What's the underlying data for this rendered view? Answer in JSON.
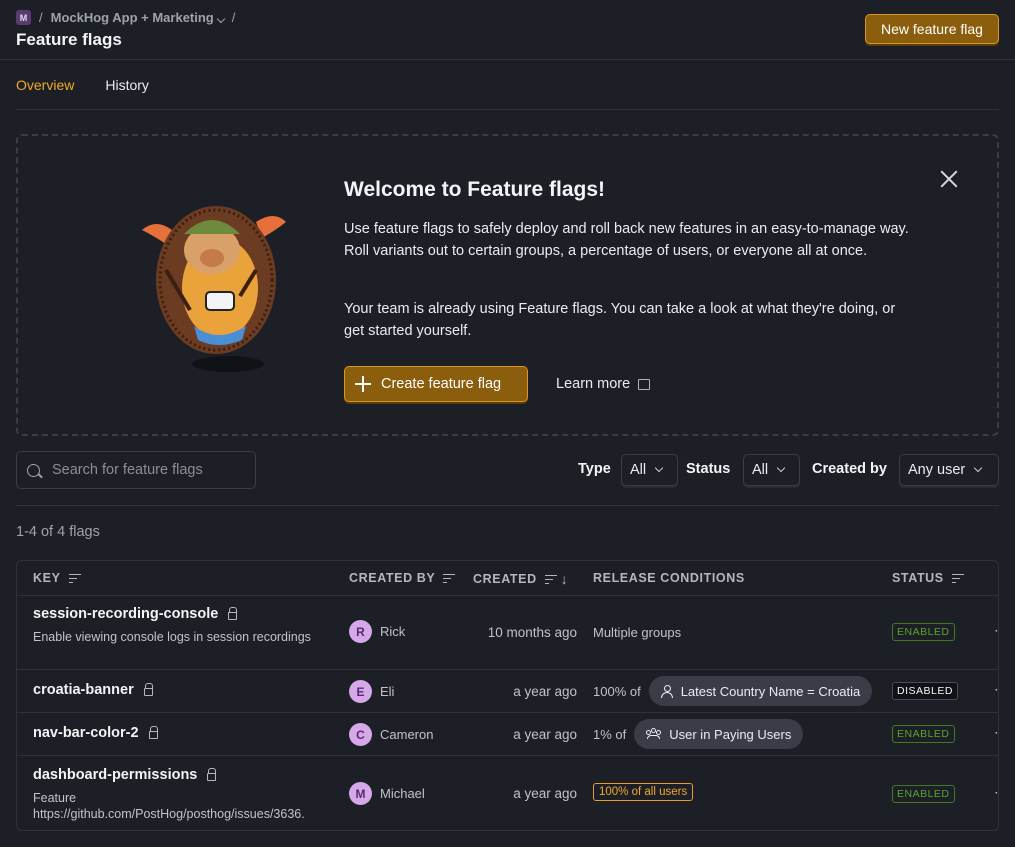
{
  "breadcrumb": {
    "badge": "M",
    "sep1": "/",
    "project": "MockHog App + Marketing",
    "sep2": "/"
  },
  "page_title": "Feature flags",
  "new_flag_button": "New feature flag",
  "tabs": [
    {
      "label": "Overview",
      "active": true
    },
    {
      "label": "History",
      "active": false
    }
  ],
  "banner": {
    "title": "Welcome to Feature flags!",
    "paragraph1": "Use feature flags to safely deploy and roll back new features in an easy-to-manage way. Roll variants out to certain groups, a percentage of users, or everyone all at once.",
    "paragraph2": "Your team is already using Feature flags. You can take a look at what they're doing, or get started yourself.",
    "create_button": "Create feature flag",
    "learn_more": "Learn more"
  },
  "filters": {
    "search_placeholder": "Search for feature flags",
    "type_label": "Type",
    "type_value": "All",
    "status_label": "Status",
    "status_value": "All",
    "created_by_label": "Created by",
    "created_by_value": "Any user"
  },
  "count_text": "1-4 of 4 flags",
  "table": {
    "headers": {
      "key": "KEY",
      "created_by": "CREATED BY",
      "created": "CREATED",
      "release": "RELEASE CONDITIONS",
      "status": "STATUS"
    },
    "rows": [
      {
        "key": "session-recording-console",
        "description": "Enable viewing console logs in session recordings",
        "creator_initial": "R",
        "creator": "Rick",
        "created": "10 months ago",
        "release_text": "Multiple groups",
        "status": "ENABLED",
        "more": "⋯"
      },
      {
        "key": "croatia-banner",
        "description": "",
        "creator_initial": "E",
        "creator": "Eli",
        "created": "a year ago",
        "release_prefix": "100% of",
        "release_condition": "Latest Country Name = Croatia",
        "status": "DISABLED",
        "more": "⋯"
      },
      {
        "key": "nav-bar-color-2",
        "description": "",
        "creator_initial": "C",
        "creator": "Cameron",
        "created": "a year ago",
        "release_prefix": "1% of",
        "release_condition": "User in Paying Users",
        "status": "ENABLED",
        "more": "⋯"
      },
      {
        "key": "dashboard-permissions",
        "description": "Feature https://github.com/PostHog/posthog/issues/3636.",
        "creator_initial": "M",
        "creator": "Michael",
        "created": "a year ago",
        "release_tag": "100% of all users",
        "status": "ENABLED",
        "more": "⋯"
      }
    ]
  },
  "colors": {
    "accent": "#f1a82c",
    "button_bg": "#8a5e0c",
    "enabled": "#5ba52a",
    "background": "#1d1f27"
  }
}
